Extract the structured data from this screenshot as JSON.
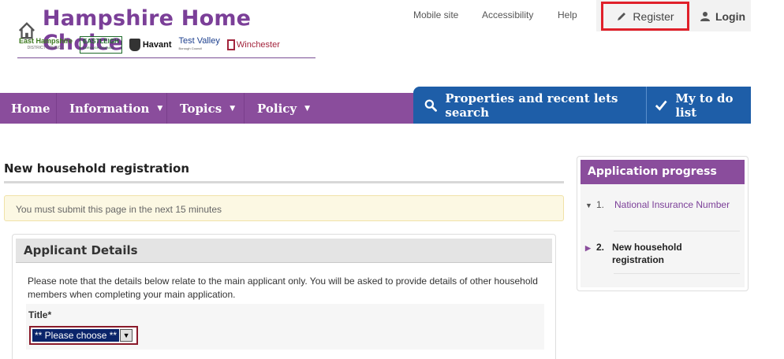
{
  "header": {
    "site_title": "Hampshire Home Choice",
    "councils": {
      "east_hampshire": "East Hampshire",
      "east_hampshire_sub": "DISTRICT COUNCIL",
      "eastleigh": "EASTLEIGH",
      "eastleigh_sub": "BOROUGH COUNCIL",
      "havant": "Havant",
      "test_valley": "Test Valley",
      "test_valley_sub": "Borough Council",
      "winchester": "Winchester"
    }
  },
  "utility_links": {
    "mobile": "Mobile site",
    "accessibility": "Accessibility",
    "help": "Help",
    "register": "Register",
    "login": "Login"
  },
  "nav": {
    "home": "Home",
    "information": "Information",
    "topics": "Topics",
    "policy": "Policy",
    "search": "Properties and recent lets search",
    "todo": "My to do list"
  },
  "main": {
    "page_title": "New household registration",
    "timer_note": "You must submit this page in the next 15 minutes",
    "section_title": "Applicant Details",
    "section_note": "Please note that the details below relate to the main applicant only. You will be asked to provide details of other household members when completing your main application.",
    "title_label": "Title*",
    "title_selected": "** Please choose **"
  },
  "sidebar": {
    "title": "Application progress",
    "steps": [
      {
        "num": "1.",
        "label": "National Insurance Number"
      },
      {
        "num": "2.",
        "label": "New household registration"
      }
    ]
  },
  "colors": {
    "brand_purple": "#8a4d9c",
    "nav_blue": "#1e5ea8",
    "highlight_red": "#e0202a"
  }
}
